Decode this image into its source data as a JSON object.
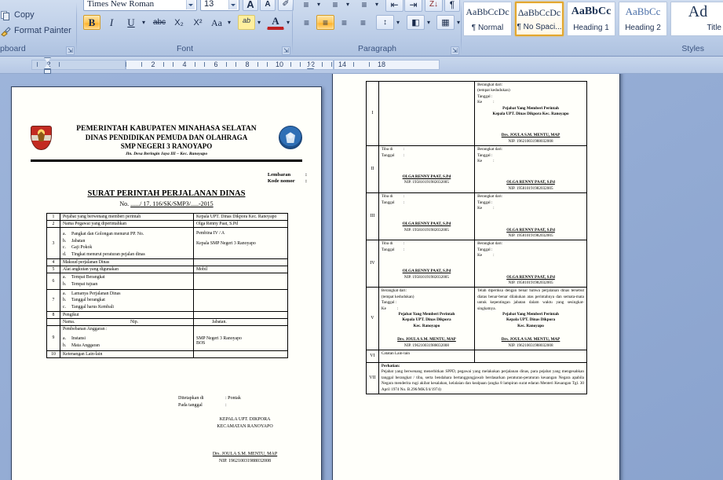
{
  "ribbon": {
    "clipboard": {
      "label": "pboard",
      "items": [
        {
          "name": "Copy",
          "icon": "copy-icon"
        },
        {
          "name": "Format Painter",
          "icon": "paintbrush-icon"
        }
      ]
    },
    "font": {
      "label": "Font",
      "font_name": "Times New Roman",
      "font_size": "13",
      "buttons": [
        {
          "name": "grow-font",
          "glyph": "A"
        },
        {
          "name": "shrink-font",
          "glyph": "A"
        },
        {
          "name": "clear-formatting",
          "glyph": "✐"
        },
        {
          "name": "bold",
          "glyph": "B"
        },
        {
          "name": "italic",
          "glyph": "I"
        },
        {
          "name": "underline",
          "glyph": "U"
        },
        {
          "name": "strikethrough",
          "glyph": "abc"
        },
        {
          "name": "subscript",
          "glyph": "X₂"
        },
        {
          "name": "superscript",
          "glyph": "X²"
        },
        {
          "name": "change-case",
          "glyph": "Aa"
        },
        {
          "name": "text-highlight-color",
          "glyph": "ab"
        },
        {
          "name": "font-color",
          "glyph": "A"
        }
      ]
    },
    "paragraph": {
      "label": "Paragraph",
      "buttons": [
        {
          "name": "bullets",
          "glyph": "≡"
        },
        {
          "name": "numbering",
          "glyph": "≡"
        },
        {
          "name": "multilevel-list",
          "glyph": "≡"
        },
        {
          "name": "decrease-indent",
          "glyph": "⇤"
        },
        {
          "name": "increase-indent",
          "glyph": "⇥"
        },
        {
          "name": "sort",
          "glyph": "Z↓"
        },
        {
          "name": "show-formatting-marks",
          "glyph": "¶"
        },
        {
          "name": "align-left",
          "glyph": "≡"
        },
        {
          "name": "align-center",
          "glyph": "≡"
        },
        {
          "name": "align-right",
          "glyph": "≡"
        },
        {
          "name": "justify",
          "glyph": "≡"
        },
        {
          "name": "line-spacing",
          "glyph": "↕"
        },
        {
          "name": "shading",
          "glyph": "◧"
        },
        {
          "name": "borders",
          "glyph": "▦"
        }
      ]
    },
    "styles": {
      "label": "Styles",
      "gallery": [
        {
          "preview": "AaBbCcDc",
          "name": "¶ Normal",
          "selected": false
        },
        {
          "preview": "ΔaBbCcDc",
          "name": "¶ No Spaci...",
          "selected": true
        },
        {
          "preview": "AaBbCс",
          "name": "Heading 1",
          "selected": false
        },
        {
          "preview": "AaBbCc",
          "name": "Heading 2",
          "selected": false
        },
        {
          "preview": "Ad",
          "name": "Title",
          "selected": false
        }
      ]
    }
  },
  "ruler": {
    "left_marks": [
      "2"
    ],
    "marks": [
      "2",
      "4",
      "6",
      "8",
      "10",
      "12",
      "14",
      "18"
    ]
  },
  "page1": {
    "letterhead": {
      "line1": "PEMERINTAH KABUPATEN MINAHASA SELATAN",
      "line2": "DINAS PENDIDIKAN PEMUDA DAN OLAHRAGA",
      "line3": "SMP NEGERI 3 RANOYAPO",
      "line4": "Jln. Desa Beringin Jaya III – Kec. Ranoyapo",
      "emblem_left": "kabupaten-crest-icon",
      "emblem_right": "tut-wuri-handayani-icon"
    },
    "kode": {
      "lembaran_label": "Lembaran",
      "lembaran_value": ":",
      "kode_label": "Kode nomor",
      "kode_value": ":"
    },
    "title": "SURAT PERINTAH PERJALANAN DINAS",
    "number_prefix": "No.",
    "number_blank1": "......",
    "number_mid": "/ 17. 116/SK/SMP3/",
    "number_blank2": ".....",
    "number_year": "-2015",
    "rows": [
      {
        "no": "1",
        "item": "Pejabat yang berwenang memberi perintah",
        "value": "Kepala UPT. Dinas Dikpora Kec. Ranoyapo"
      },
      {
        "no": "2",
        "item": "Nama Pegawai yang diperintahkan",
        "value": "Olga Renny Paat, S.Pd"
      },
      {
        "no": "3",
        "item_subs": [
          {
            "k": "a.",
            "t": "Pangkat dan Golongan menurut PP. No."
          },
          {
            "k": "b.",
            "t": "Jabatan"
          },
          {
            "k": "c.",
            "t": "Gaji Pokok"
          },
          {
            "k": "d.",
            "t": "Tingkat menurut peraturan pejalan dinas"
          }
        ],
        "value_lines": [
          "Pembina IV / A",
          "",
          "Kepala SMP Negeri 3 Ranoyapo"
        ]
      },
      {
        "no": "4",
        "item": "Maksud perjalanan Dinas",
        "value": ""
      },
      {
        "no": "5",
        "item": "Alat angkutan yang digunakan",
        "value": "Mobil"
      },
      {
        "no": "6",
        "item_subs": [
          {
            "k": "a.",
            "t": "Tempat Berangkat"
          },
          {
            "k": "b.",
            "t": "Tempat tujuan"
          }
        ],
        "value_lines": []
      },
      {
        "no": "7",
        "item_subs": [
          {
            "k": "a.",
            "t": "Lamanya Perjalanan Dinas"
          },
          {
            "k": "b.",
            "t": "Tanggal berangkat"
          },
          {
            "k": "c.",
            "t": "Tanggal harus Kembali"
          }
        ],
        "value_lines": []
      },
      {
        "no": "8",
        "item": "Pengikut",
        "value": ""
      },
      {
        "no": "",
        "item_cols": [
          "Nama.",
          "Nip.",
          "Jabatan."
        ],
        "value": ""
      },
      {
        "no": "9",
        "item_head": "Pembebanan Anggaran :",
        "item_subs": [
          {
            "k": "a.",
            "t": "Instansi"
          },
          {
            "k": "b.",
            "t": "Mata Anggaran"
          }
        ],
        "value_lines": [
          "SMP Negeri 3 Ranoyapo",
          "BOS"
        ]
      },
      {
        "no": "10",
        "item": "Ketenangan Lain-lain",
        "value": ""
      }
    ],
    "signature": {
      "place_label": "Ditetapkan di",
      "place_value": ": Pontak",
      "date_label": "Pada tanggal",
      "date_value": ":",
      "office_line1": "KEPALA UPT. DIKPORA",
      "office_line2": "KECAMATAN  RANOYAPO",
      "name": "Drs. JOULA S.M. MENTU, MAP",
      "nip": "NIP. 196210031988032008"
    }
  },
  "page2": {
    "officials": {
      "kepala_name": "Drs. JOULA S.M. MENTU, MAP",
      "kepala_nip": "NIP. 196210031988032008",
      "kepala_title1": "Pejabat Yang Memberi Perintah",
      "kepala_title2": "Kepala UPT. Dinas Dikpora Kec. Ranoyapo",
      "kepala_title2a": "Kepala UPT. Dinas Dikpora",
      "kepala_title2b": "Kec. Ranoyapo",
      "pegawai_name": "OLGA RENNY PAAT, S.Pd",
      "pegawai_nip": "NIP. 195810191982032005"
    },
    "labels": {
      "berangkat_dari": "Berangkat dari:",
      "tempat_kedudukan": "(tempat kedudukan)",
      "tanggal": "Tanggal :",
      "ke": "Ke",
      "tiba_di": "Tiba di",
      "tanggal2": "Tanggal",
      "colon": ":"
    },
    "rows": [
      {
        "no": "I"
      },
      {
        "no": "II"
      },
      {
        "no": "III"
      },
      {
        "no": "IV"
      },
      {
        "no": "V"
      }
    ],
    "row5_right_text": "Telah diperiksa dengan benar bahwa perjalanan dinas tersebut diatas benar-benar dilakukan atas perintahnya dan semata-mata untuk kepentingan jabatan dalam waktu yang sesingkat-singkatnya.",
    "row6": {
      "no": "VI",
      "text": "Catatan Lain-lain"
    },
    "row7": {
      "no": "VII",
      "heading": "Perhatian:",
      "text": "Pejabat yang berwenang menerbitkan SPPD, pegawai yang melakukan perjalanan dinas, para pejabat yang mengesahkan tanggal berangkat / tiba, serta bendahara bertanggungjawab berdasarkan peraturan-peraturan keuangan Negara apabila Negara menderita rugi akibat kesalahan, kelalaian dan kealpaan (angka 8 lampiran surat edaran Menteri Keuangan Tgl. 30 April 1974 No. B.296/MK/I/4/1974)"
    }
  },
  "colors": {
    "ribbon_bg": "#c3d3ea",
    "canvas_bg": "#93abd5",
    "accent_selected": "#ffb125",
    "page_bg": "#fffffa"
  }
}
